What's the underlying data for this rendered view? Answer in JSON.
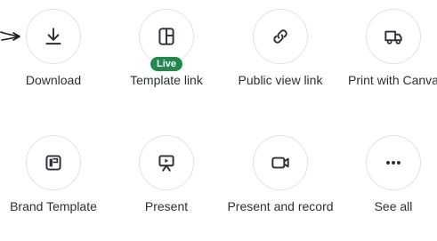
{
  "actions": [
    {
      "label": "Download",
      "icon": "download-icon"
    },
    {
      "label": "Template link",
      "icon": "template-link-icon",
      "badge": "Live"
    },
    {
      "label": "Public view link",
      "icon": "link-icon"
    },
    {
      "label": "Print with Canva",
      "icon": "truck-icon"
    },
    {
      "label": "Brand Template",
      "icon": "brand-template-icon"
    },
    {
      "label": "Present",
      "icon": "present-icon"
    },
    {
      "label": "Present and record",
      "icon": "camera-icon"
    },
    {
      "label": "See all",
      "icon": "more-icon"
    }
  ],
  "colors": {
    "badge_bg": "#1f8a4c",
    "text": "#2b2f36",
    "circle_border": "#dfe2e8"
  }
}
